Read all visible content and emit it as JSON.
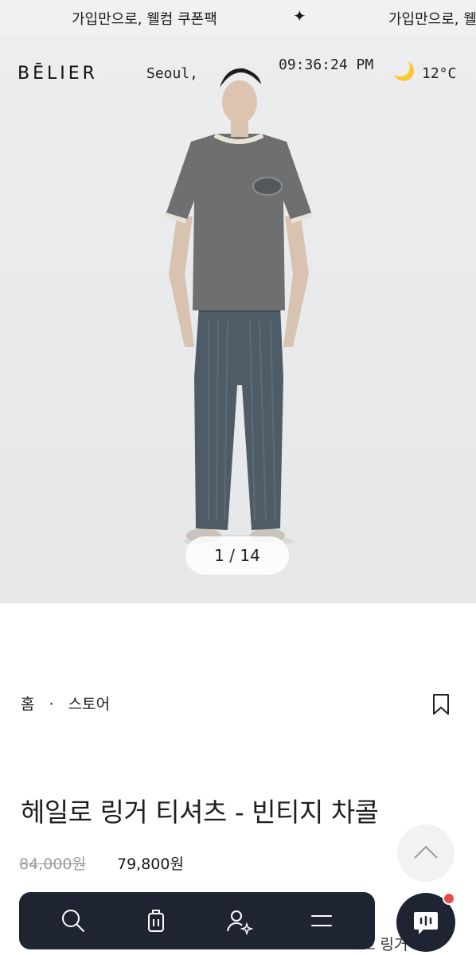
{
  "banner": {
    "promo_text": "가입만으로, 웰컴 쿠폰팩",
    "separator_icon": "sparkle-icon"
  },
  "header": {
    "logo": "BĒLIER",
    "city": "Seoul,",
    "time": "09:36:24 PM",
    "weather_icon": "crescent-moon-icon",
    "temperature": "12°C"
  },
  "gallery": {
    "counter": "1 / 14"
  },
  "product": {
    "breadcrumb": [
      "홈",
      "스토어"
    ],
    "breadcrumb_separator": "·",
    "title": "헤일로 링거 티셔츠 - 빈티지 차콜",
    "original_price": "84,000원",
    "sale_price": "79,800원"
  },
  "footer_peek_text": "고 링거 티",
  "colors": {
    "nav_bg": "#1f2433",
    "badge_red": "#e84b47",
    "moon_yellow": "#f3b21b"
  },
  "bottom_nav": {
    "items": [
      "search-icon",
      "shopping-bag-icon",
      "user-sparkle-icon",
      "menu-icon"
    ]
  }
}
